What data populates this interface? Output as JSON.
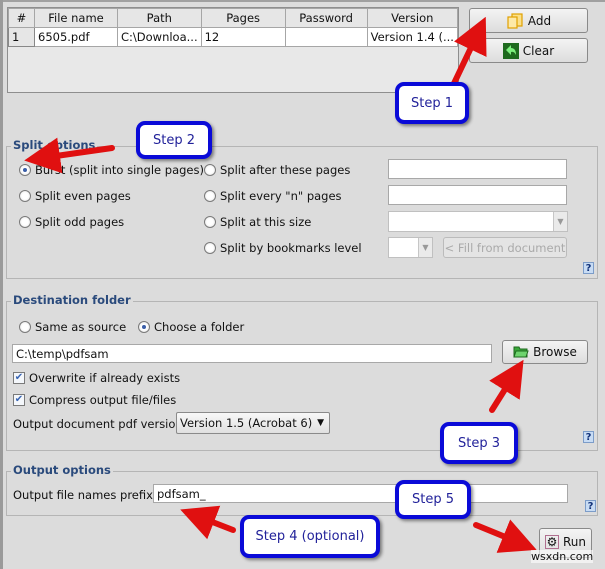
{
  "file_table": {
    "columns": [
      "#",
      "File name",
      "Path",
      "Pages",
      "Password",
      "Version"
    ],
    "rows": [
      [
        "1",
        "6505.pdf",
        "C:\\Downloa...",
        "12",
        "",
        "Version 1.4 (..."
      ]
    ]
  },
  "buttons": {
    "add": "Add",
    "clear": "Clear",
    "browse": "Browse",
    "run": "Run",
    "fill_from_document": "< Fill from document"
  },
  "split_options": {
    "title": "Split options",
    "options": [
      {
        "label": "Burst (split into single pages)",
        "selected": true
      },
      {
        "label": "Split even pages",
        "selected": false
      },
      {
        "label": "Split odd pages",
        "selected": false
      },
      {
        "label": "Split after these pages",
        "selected": false
      },
      {
        "label": "Split every \"n\" pages",
        "selected": false
      },
      {
        "label": "Split at this size",
        "selected": false
      },
      {
        "label": "Split by bookmarks level",
        "selected": false
      }
    ],
    "after_pages_value": "",
    "every_n_value": "",
    "size_value": "",
    "bookmark_level_value": ""
  },
  "destination": {
    "title": "Destination folder",
    "same_as_source": "Same as source",
    "choose_folder": "Choose a folder",
    "selected": "choose_folder",
    "folder_path": "C:\\temp\\pdfsam",
    "overwrite_label": "Overwrite if already exists",
    "overwrite_checked": true,
    "compress_label": "Compress output file/files",
    "compress_checked": true,
    "pdf_version_label": "Output document pdf version:",
    "pdf_version_value": "Version 1.5 (Acrobat 6)"
  },
  "output_options": {
    "title": "Output options",
    "prefix_label": "Output file names prefix:",
    "prefix_value": "pdfsam_"
  },
  "help_glyph": "?",
  "callouts": {
    "step1": "Step 1",
    "step2": "Step 2",
    "step3": "Step 3",
    "step4": "Step 4 (optional)",
    "step5": "Step 5"
  },
  "watermark": "wsxdn.com",
  "colors": {
    "callout_border": "#0a0ad8",
    "arrow": "#e01010",
    "legend_text": "#2a4a7c"
  }
}
